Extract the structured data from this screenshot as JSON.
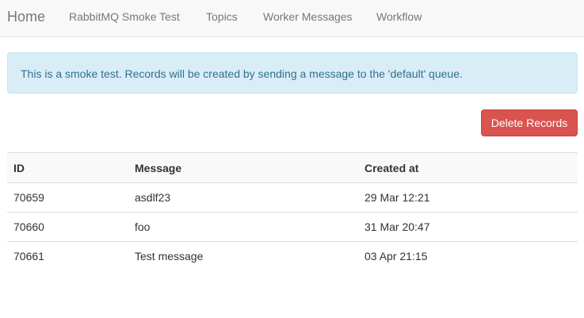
{
  "navbar": {
    "brand": "Home",
    "links": [
      "RabbitMQ Smoke Test",
      "Topics",
      "Worker Messages",
      "Workflow"
    ]
  },
  "alert": {
    "text": "This is a smoke test. Records will be created by sending a message to the 'default' queue."
  },
  "actions": {
    "delete_label": "Delete Records"
  },
  "table": {
    "headers": [
      "ID",
      "Message",
      "Created at"
    ],
    "rows": [
      [
        "70659",
        "asdlf23",
        "29 Mar 12:21"
      ],
      [
        "70660",
        "foo",
        "31 Mar 20:47"
      ],
      [
        "70661",
        "Test message",
        "03 Apr 21:15"
      ]
    ]
  },
  "colors": {
    "navbar_bg": "#f8f8f8",
    "alert_bg": "#d9edf7",
    "alert_text": "#31708f",
    "danger": "#d9534f"
  }
}
